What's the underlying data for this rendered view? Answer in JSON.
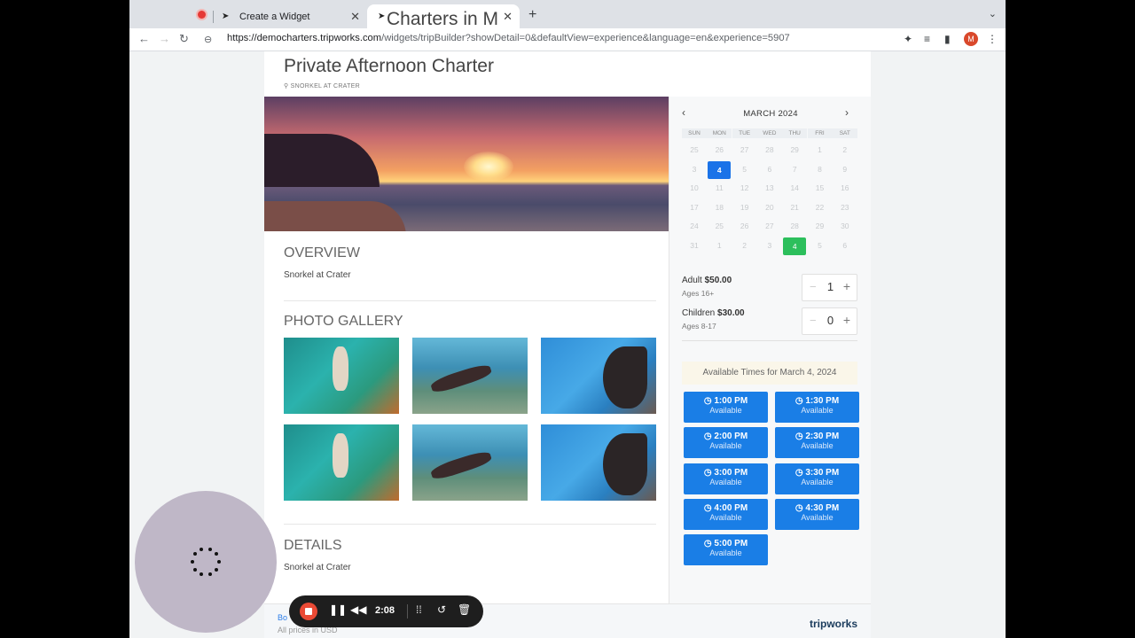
{
  "browser": {
    "tabs": [
      {
        "label": "Create a Widget",
        "active": false
      },
      {
        "label": "Charters in Maui Tickets: TripW",
        "active": true
      }
    ],
    "url_host": "https://democharters.tripworks.com",
    "url_path": "/widgets/tripBuilder?showDetail=0&defaultView=experience&language=en&experience=5907",
    "profile_initial": "M"
  },
  "experience": {
    "title": "Private Afternoon Charter",
    "location": "SNORKEL AT CRATER",
    "overview_heading": "OVERVIEW",
    "overview_text": "Snorkel at Crater",
    "gallery_heading": "PHOTO GALLERY",
    "details_heading": "DETAILS",
    "details_text": "Snorkel at Crater"
  },
  "calendar": {
    "month": "MARCH 2024",
    "weekdays": [
      "SUN",
      "MON",
      "TUE",
      "WED",
      "THU",
      "FRI",
      "SAT"
    ],
    "weeks": [
      [
        "25",
        "26",
        "27",
        "28",
        "29",
        "1",
        "2"
      ],
      [
        "3",
        "4",
        "5",
        "6",
        "7",
        "8",
        "9"
      ],
      [
        "10",
        "11",
        "12",
        "13",
        "14",
        "15",
        "16"
      ],
      [
        "17",
        "18",
        "19",
        "20",
        "21",
        "22",
        "23"
      ],
      [
        "24",
        "25",
        "26",
        "27",
        "28",
        "29",
        "30"
      ],
      [
        "31",
        "1",
        "2",
        "3",
        "4",
        "5",
        "6"
      ]
    ],
    "selected_day": "4",
    "available_day": "4"
  },
  "tickets": [
    {
      "type": "Adult",
      "price": "$50.00",
      "ages": "Ages 16+",
      "quantity": "1"
    },
    {
      "type": "Children",
      "price": "$30.00",
      "ages": "Ages 8-17",
      "quantity": "0"
    }
  ],
  "times": {
    "header": "Available Times for March 4, 2024",
    "slots": [
      {
        "time": "1:00 PM",
        "status": "Available"
      },
      {
        "time": "1:30 PM",
        "status": "Available"
      },
      {
        "time": "2:00 PM",
        "status": "Available"
      },
      {
        "time": "2:30 PM",
        "status": "Available"
      },
      {
        "time": "3:00 PM",
        "status": "Available"
      },
      {
        "time": "3:30 PM",
        "status": "Available"
      },
      {
        "time": "4:00 PM",
        "status": "Available"
      },
      {
        "time": "4:30 PM",
        "status": "Available"
      },
      {
        "time": "5:00 PM",
        "status": "Available"
      }
    ]
  },
  "footer": {
    "book_link": "Bo",
    "prices_note": "All prices in USD",
    "logo": "tripworks"
  },
  "recorder": {
    "elapsed": "2:08"
  }
}
